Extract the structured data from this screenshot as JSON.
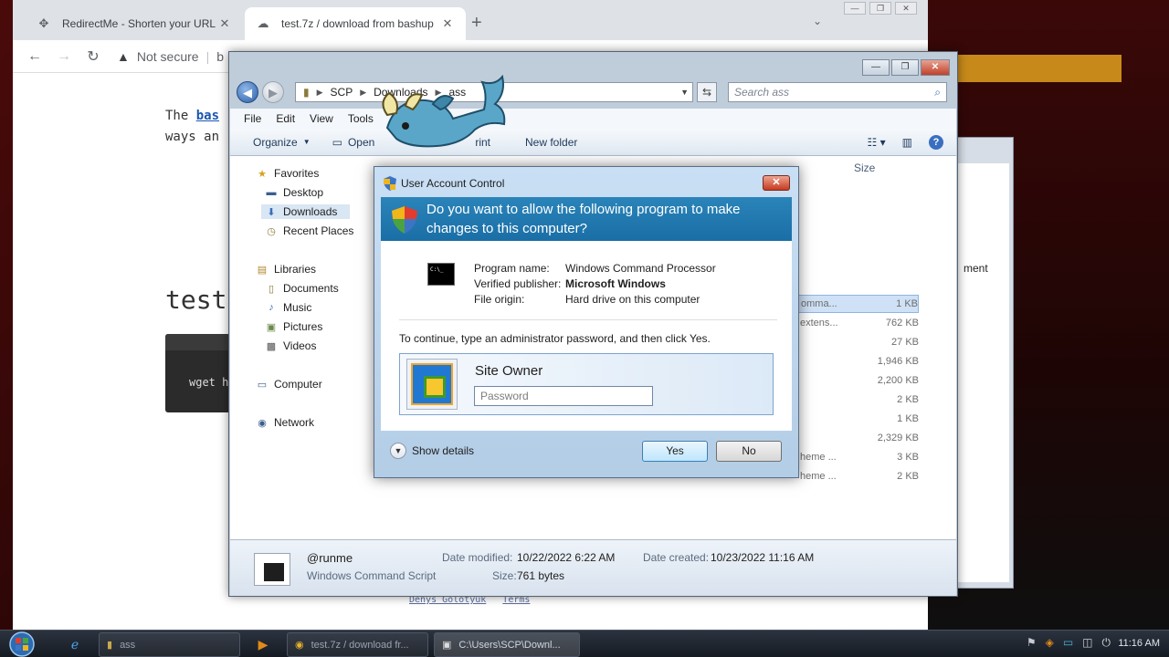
{
  "browser": {
    "tabs": [
      {
        "title": "RedirectMe - Shorten your URL",
        "icon": "redirect-icon"
      },
      {
        "title": "test.7z / download from bashup",
        "icon": "cloud-icon"
      }
    ],
    "omnibox": {
      "security": "Not secure",
      "url_fragment": "b"
    },
    "page": {
      "intro_prefix": "The ",
      "intro_link": "bas",
      "intro_line2": "ways an",
      "heading": "test",
      "code_snippet": "wget h",
      "footer_links": [
        "Denys Golotyuk",
        "Terms"
      ]
    }
  },
  "explorer": {
    "breadcrumb": [
      "SCP",
      "Downloads",
      "ass"
    ],
    "search_placeholder": "Search ass",
    "menu": [
      "File",
      "Edit",
      "View",
      "Tools"
    ],
    "commands": {
      "organize": "Organize",
      "open": "Open",
      "print": "rint",
      "new_folder": "New folder"
    },
    "nav": {
      "favorites": "Favorites",
      "desktop": "Desktop",
      "downloads": "Downloads",
      "recent_places": "Recent Places",
      "libraries": "Libraries",
      "documents": "Documents",
      "music": "Music",
      "pictures": "Pictures",
      "videos": "Videos",
      "computer": "Computer",
      "network": "Network"
    },
    "column_size": "Size",
    "files": [
      {
        "name": "omma...",
        "size": "1 KB"
      },
      {
        "name": "extens...",
        "size": "762 KB"
      },
      {
        "name": "",
        "size": "27 KB"
      },
      {
        "name": "",
        "size": "1,946 KB"
      },
      {
        "name": "",
        "size": "2,200 KB"
      },
      {
        "name": "",
        "size": "2 KB"
      },
      {
        "name": "",
        "size": "1 KB"
      },
      {
        "name": "",
        "size": "2,329 KB"
      },
      {
        "name": "heme ...",
        "size": "3 KB"
      },
      {
        "name": "heme ...",
        "size": "2 KB"
      }
    ],
    "details": {
      "name": "@runme",
      "type": "Windows Command Script",
      "modified_label": "Date modified:",
      "modified": "10/22/2022 6:22 AM",
      "created_label": "Date created:",
      "created": "10/23/2022 11:16 AM",
      "size_label": "Size:",
      "size": "761 bytes"
    }
  },
  "background_window": {
    "label": "ment"
  },
  "uac": {
    "title": "User Account Control",
    "question": "Do you want to allow the following program to make changes to this computer?",
    "program_name_label": "Program name:",
    "program_name": "Windows Command Processor",
    "publisher_label": "Verified publisher:",
    "publisher": "Microsoft Windows",
    "origin_label": "File origin:",
    "origin": "Hard drive on this computer",
    "instruction": "To continue, type an administrator password, and then click Yes.",
    "user": "Site Owner",
    "password_placeholder": "Password",
    "show_details": "Show details",
    "yes": "Yes",
    "no": "No",
    "cmd_icon_text": "C:\\_"
  },
  "taskbar": {
    "items": [
      {
        "label": "ass"
      },
      {
        "label": "test.7z / download fr..."
      },
      {
        "label": "C:\\Users\\SCP\\Downl..."
      }
    ],
    "clock": "11:16 AM"
  },
  "colors": {
    "uac_banner": "#1a6ea6",
    "accent": "#3c7fb1"
  }
}
